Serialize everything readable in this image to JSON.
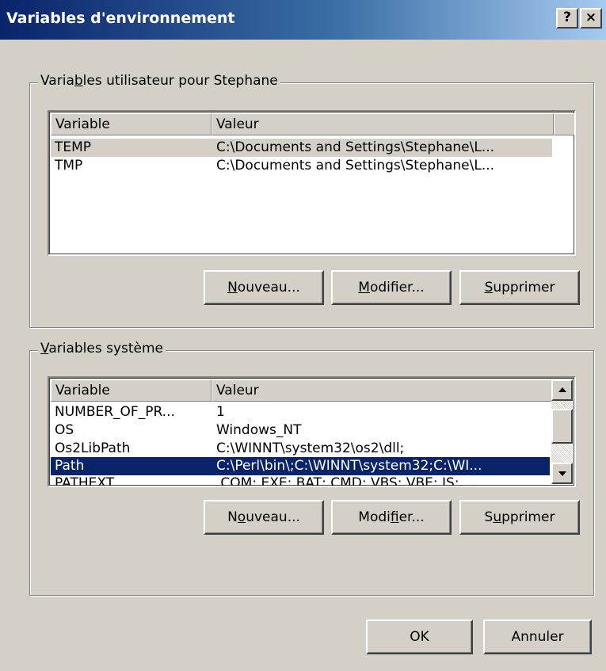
{
  "window": {
    "title": "Variables d'environnement",
    "help_glyph": "?",
    "close_glyph": "×"
  },
  "user_group": {
    "legend_pre": "Varia",
    "legend_key": "b",
    "legend_post": "les utilisateur pour Stephane",
    "columns": [
      "Variable",
      "Valeur"
    ],
    "rows": [
      {
        "variable": "TEMP",
        "value": "C:\\Documents and Settings\\Stephane\\L...",
        "selected": "gray"
      },
      {
        "variable": "TMP",
        "value": "C:\\Documents and Settings\\Stephane\\L...",
        "selected": ""
      }
    ],
    "buttons": {
      "new": {
        "key": "N",
        "rest": "ouveau..."
      },
      "edit": {
        "key": "M",
        "rest": "odifier..."
      },
      "delete": {
        "key": "S",
        "rest": "upprimer"
      }
    }
  },
  "system_group": {
    "legend_key": "V",
    "legend_rest": "ariables système",
    "columns": [
      "Variable",
      "Valeur"
    ],
    "rows": [
      {
        "variable": "NUMBER_OF_PR...",
        "value": "1",
        "selected": ""
      },
      {
        "variable": "OS",
        "value": "Windows_NT",
        "selected": ""
      },
      {
        "variable": "Os2LibPath",
        "value": "C:\\WINNT\\system32\\os2\\dll;",
        "selected": ""
      },
      {
        "variable": "Path",
        "value": "C:\\Perl\\bin\\;C:\\WINNT\\system32;C:\\WI...",
        "selected": "blue"
      },
      {
        "variable": "PATHEXT",
        "value": ".COM;.EXE;.BAT;.CMD;.VBS;.VBE;.JS;....",
        "selected": ""
      }
    ],
    "buttons": {
      "new": {
        "pre": "N",
        "key": "o",
        "post": "uveau..."
      },
      "edit": {
        "pre": "Modi",
        "key": "f",
        "post": "ier..."
      },
      "delete": {
        "pre": "S",
        "key": "u",
        "post": "pprimer"
      }
    }
  },
  "footer": {
    "ok_label": "OK",
    "cancel_label": "Annuler"
  }
}
